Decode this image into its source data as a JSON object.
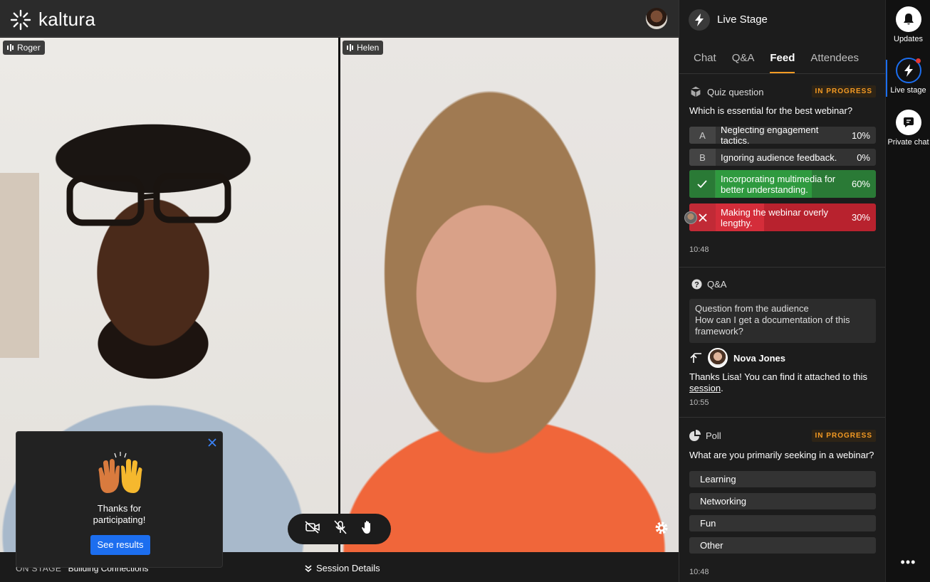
{
  "app": {
    "logo_text": "kaltura"
  },
  "stage": {
    "participants": [
      {
        "name": "Roger"
      },
      {
        "name": "Helen"
      }
    ],
    "bottom": {
      "on_stage_label": "ON STAGE",
      "session_name": "Building Connections",
      "details_label": "Session Details"
    },
    "controls": {
      "icons": [
        "camera-off-icon",
        "mic-off-icon",
        "raise-hand-icon"
      ]
    }
  },
  "popup": {
    "message": "Thanks for participating!",
    "button": "See results"
  },
  "panel": {
    "title": "Live Stage",
    "tabs": [
      {
        "label": "Chat"
      },
      {
        "label": "Q&A"
      },
      {
        "label": "Feed"
      },
      {
        "label": "Attendees"
      }
    ],
    "active_tab": "Feed",
    "quiz": {
      "header": "Quiz question",
      "status": "IN PROGRESS",
      "question": "Which is essential for the best webinar?",
      "options": [
        {
          "letter": "A",
          "text": "Neglecting engagement tactics.",
          "percent": "10%",
          "value": 0.1
        },
        {
          "letter": "B",
          "text": "Ignoring audience feedback.",
          "percent": "0%",
          "value": 0.0
        },
        {
          "letter": "",
          "text": "Incorporating multimedia for better understanding.",
          "percent": "60%",
          "value": 0.6,
          "state": "correct"
        },
        {
          "letter": "",
          "text": "Making the webinar overly lengthy.",
          "percent": "30%",
          "value": 0.3,
          "state": "wrong"
        }
      ],
      "time": "10:48"
    },
    "qa": {
      "header": "Q&A",
      "question_title": "Question from the audience",
      "question_text": "How can I get a documentation of this framework?",
      "answerer": "Nova Jones",
      "answer_text": "Thanks Lisa! You can find it attached to this ",
      "answer_link": "session",
      "answer_end": ".",
      "time": "10:55"
    },
    "poll": {
      "header": "Poll",
      "status": "IN PROGRESS",
      "question": "What are you primarily seeking in a webinar?",
      "options": [
        "Learning",
        "Networking",
        "Fun",
        "Other"
      ],
      "time": "10:48"
    }
  },
  "rail": {
    "items": [
      {
        "label": "Updates"
      },
      {
        "label": "Live stage"
      },
      {
        "label": "Private chat"
      }
    ],
    "more": "•••"
  },
  "colors": {
    "accent": "#f59b23",
    "primary": "#1c6eef",
    "correct": "#2f9a3f",
    "wrong": "#d42d3a"
  }
}
